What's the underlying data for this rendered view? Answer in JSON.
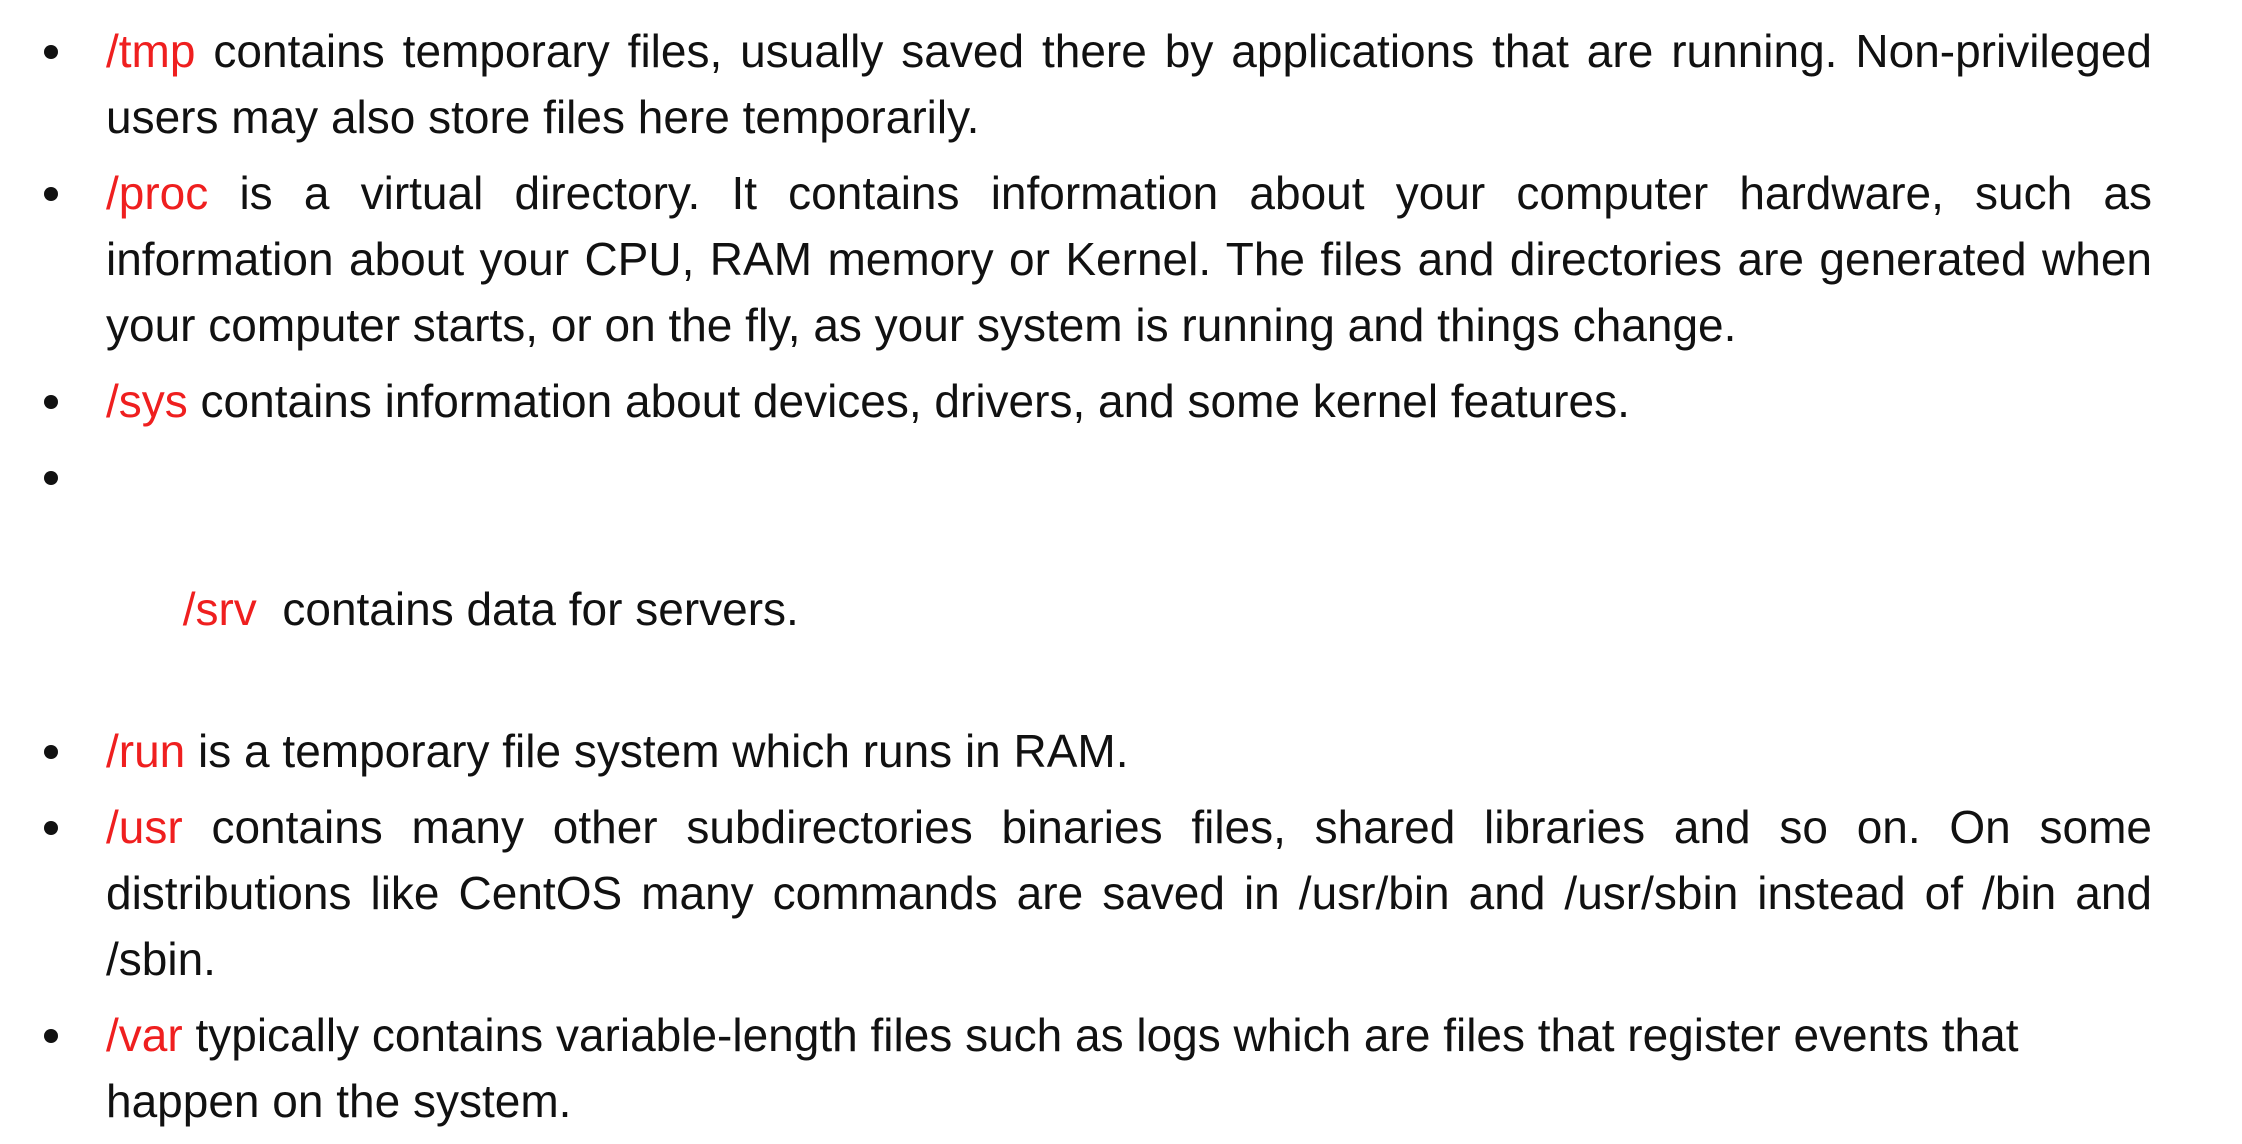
{
  "colors": {
    "path_accent": "#ef1f1f",
    "text": "#111111",
    "background": "#ffffff"
  },
  "items": [
    {
      "path": "/tmp",
      "text": " contains temporary files, usually saved there by applications that are running. Non-privileged users may also store files here temporarily."
    },
    {
      "path": "/proc",
      "text": " is a virtual directory. It contains information about your computer hardware, such as information about your CPU, RAM memory or Kernel. The files and directories are generated when your computer starts, or on the fly, as your system is running and things change."
    },
    {
      "path": "/sys",
      "text": " contains information about devices, drivers, and some kernel features."
    },
    {
      "path": "/srv",
      "text": "  contains data for servers."
    },
    {
      "path": "/run",
      "text": " is a temporary file system which runs in RAM."
    },
    {
      "path": "/usr",
      "text": " contains many other subdirectories binaries files, shared libraries and so on. On some distributions like CentOS many commands are saved in /usr/bin and /usr/sbin instead of /bin and /sbin."
    },
    {
      "path": "/var",
      "text": " typically contains variable-length files such as logs which are files that register events that happen on the system."
    }
  ]
}
